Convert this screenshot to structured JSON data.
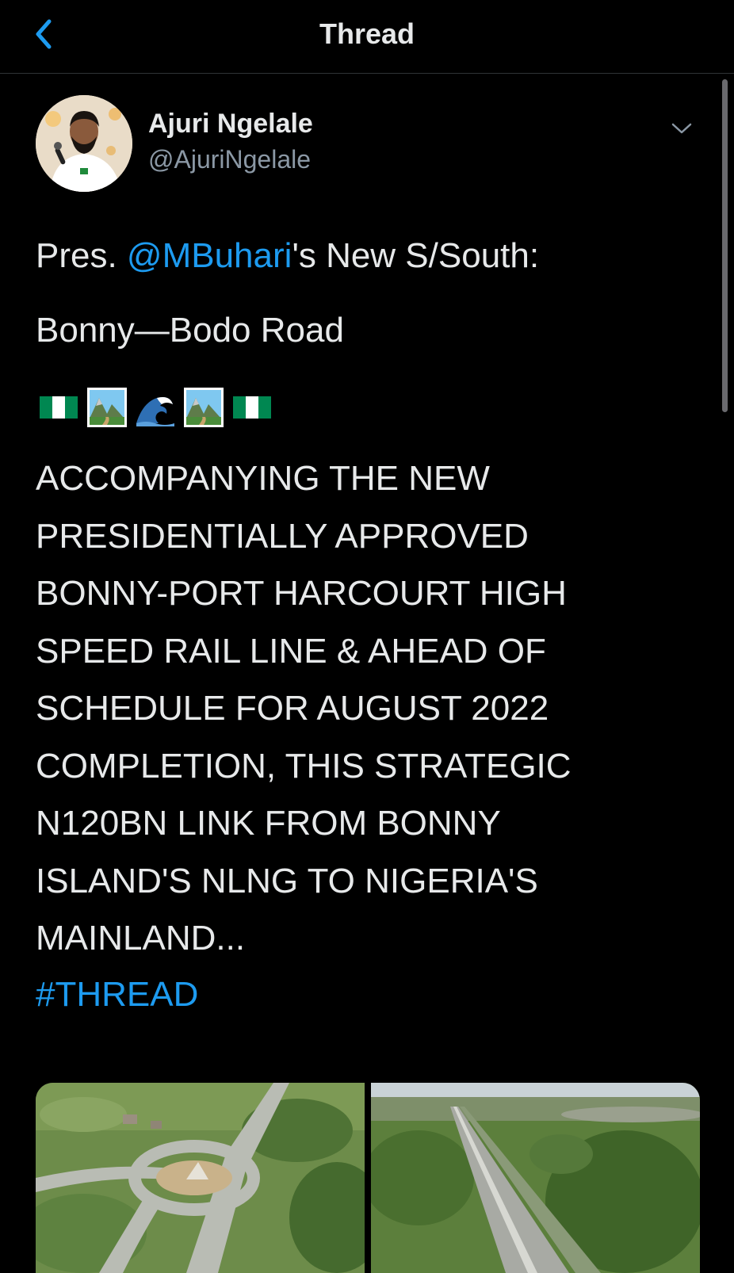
{
  "header": {
    "title": "Thread",
    "back_icon": "chevron-left-icon"
  },
  "author": {
    "name": "Ajuri Ngelale",
    "handle": "@AjuriNgelale"
  },
  "tweet": {
    "line1_prefix": "Pres. ",
    "line1_mention": "@MBuhari",
    "line1_suffix": "'s New S/South:",
    "line2": "Bonny—Bodo Road",
    "emojis": [
      "nigeria-flag-icon",
      "national-park-icon",
      "water-wave-icon",
      "national-park-icon",
      "nigeria-flag-icon"
    ],
    "body_lines": [
      "ACCOMPANYING THE NEW",
      "PRESIDENTIALLY APPROVED",
      "BONNY-PORT HARCOURT HIGH",
      "SPEED RAIL LINE & AHEAD OF",
      "SCHEDULE FOR AUGUST 2022",
      "COMPLETION, THIS STRATEGIC",
      "N120BN LINK FROM BONNY",
      "ISLAND'S NLNG TO NIGERIA'S",
      "MAINLAND..."
    ],
    "hashtag": "#THREAD"
  },
  "colors": {
    "background": "#000000",
    "text": "#e7e9ea",
    "link": "#1d9bf0",
    "secondary": "#8b98a5",
    "divider": "#2f3336"
  }
}
